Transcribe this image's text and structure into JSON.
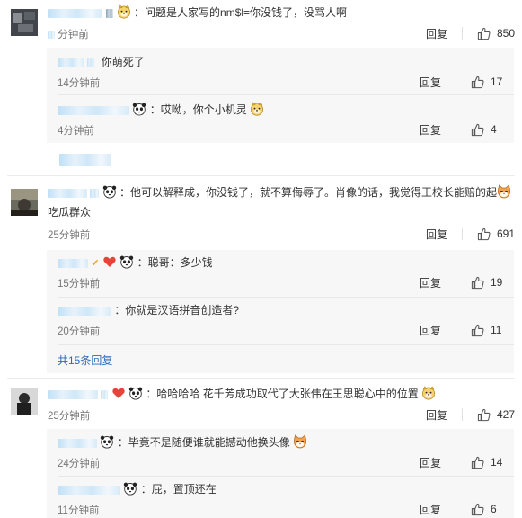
{
  "comments": [
    {
      "text": "：问题是人家写的nm$l=你没钱了，没骂人啊",
      "time": "分钟前",
      "reply": "回复",
      "likes": "850"
    },
    {
      "text": "：他可以解释成，你没钱了，就不算侮辱了。肖像的话，我觉得王校长能赔的起",
      "text_tail": "吃瓜群众",
      "time": "25分钟前",
      "reply": "回复",
      "likes": "691",
      "more_replies": "共15条回复"
    },
    {
      "text": "：哈哈哈哈 花千芳成功取代了大张伟在王思聪心中的位置",
      "time": "25分钟前",
      "reply": "回复",
      "likes": "427"
    }
  ],
  "replies1": [
    {
      "text": "你萌死了",
      "time": "14分钟前",
      "reply": "回复",
      "likes": "17"
    },
    {
      "text": "：哎呦，你个小机灵",
      "time": "4分钟前",
      "reply": "回复",
      "likes": "4"
    }
  ],
  "replies2": [
    {
      "text": "：聪哥：多少钱",
      "time": "15分钟前",
      "reply": "回复",
      "likes": "19"
    },
    {
      "text": "：你就是汉语拼音创造者?",
      "time": "20分钟前",
      "reply": "回复",
      "likes": "11"
    }
  ],
  "replies3": [
    {
      "text": "：毕竟不是随便谁就能撼动他换头像",
      "time": "24分钟前",
      "reply": "回复",
      "likes": "14"
    },
    {
      "text": "：屁，置顶还在",
      "time": "11分钟前",
      "reply": "回复",
      "likes": "6"
    }
  ],
  "colors": {
    "link": "#eb7350",
    "more": "#2a6bb6",
    "meta": "#777777",
    "subbg": "#f7f7f7"
  }
}
